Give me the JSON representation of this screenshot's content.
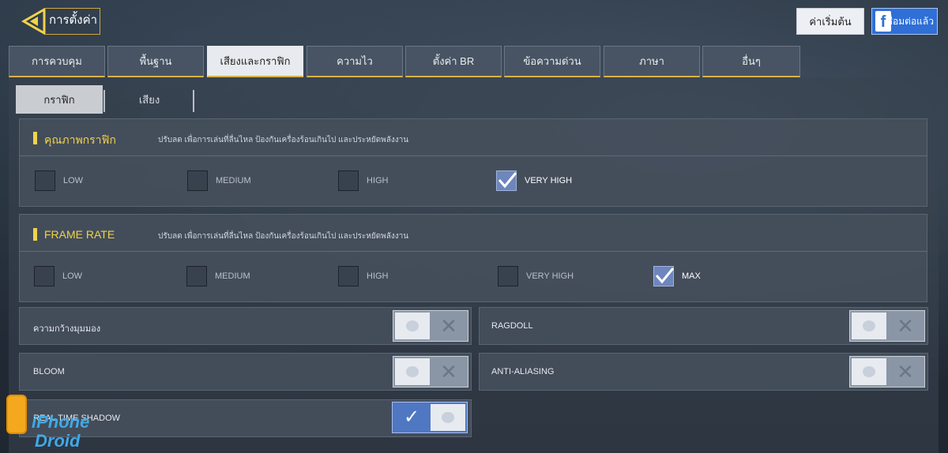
{
  "header": {
    "title": "การตั้งค่า",
    "reset_button": "ค่าเริ่มต้น",
    "facebook_button": "เชื่อมต่อแล้ว",
    "facebook_icon": "f"
  },
  "tabs": [
    "การควบคุม",
    "พื้นฐาน",
    "เสียงและกราฟิก",
    "ความไว",
    "ตั้งค่า BR",
    "ข้อความด่วน",
    "ภาษา",
    "อื่นๆ"
  ],
  "active_tab": "เสียงและกราฟิก",
  "subtabs": [
    "กราฟิก",
    "เสียง"
  ],
  "active_subtab": "กราฟิก",
  "graphics_quality": {
    "title": "คุณภาพกราฟิก",
    "description": "ปรับลด เพื่อการเล่นที่ลื่นไหล ป้องกันเครื่องร้อนเกินไป และประหยัดพลังงาน",
    "options": [
      "LOW",
      "MEDIUM",
      "HIGH",
      "VERY HIGH"
    ],
    "selected": "VERY HIGH"
  },
  "frame_rate": {
    "title": "FRAME RATE",
    "description": "ปรับลด เพื่อการเล่นที่ลื่นไหล ป้องกันเครื่องร้อนเกินไป และประหยัดพลังงาน",
    "options": [
      "LOW",
      "MEDIUM",
      "HIGH",
      "VERY HIGH",
      "MAX"
    ],
    "selected": "MAX"
  },
  "toggles": {
    "fov": {
      "label": "ความกว้างมุมมอง",
      "on": false
    },
    "ragdoll": {
      "label": "RAGDOLL",
      "on": false
    },
    "bloom": {
      "label": "BLOOM",
      "on": false
    },
    "anti_aliasing": {
      "label": "ANTI-ALIASING",
      "on": false
    },
    "realtime_shadow": {
      "label": "REAL TIME SHADOW",
      "on": true
    }
  },
  "watermark": {
    "line1": "iPhone",
    "line2": "Droid"
  },
  "colors": {
    "accent": "#f1d24a",
    "check": "#6e86bc",
    "toggle_on": "#4f77c2"
  }
}
